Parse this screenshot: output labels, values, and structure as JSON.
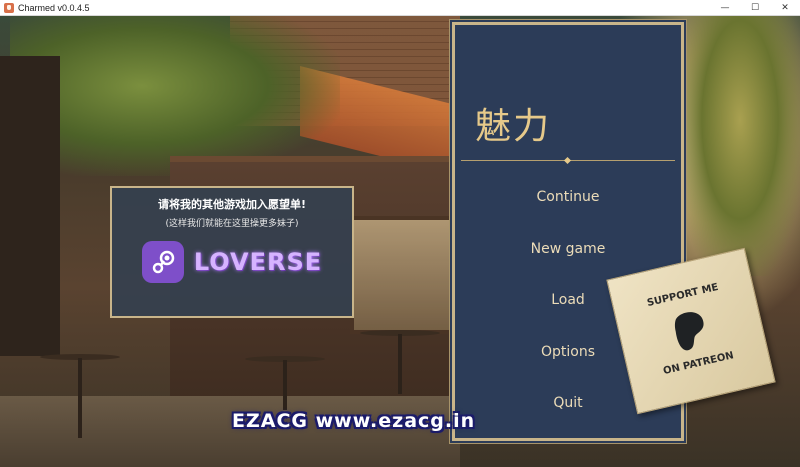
{
  "window": {
    "title": "Charmed v0.0.4.5",
    "controls": {
      "minimize": "—",
      "maximize": "☐",
      "close": "✕"
    }
  },
  "promo": {
    "headline": "请将我的其他游戏加入愿望单!",
    "subline": "(这样我们就能在这里操更多妹子)",
    "brand": "LOVERSE",
    "logo_icon": "steam-icon",
    "accent": "#7e4fc9"
  },
  "menu": {
    "title": "魅力",
    "items": [
      {
        "label": "Continue"
      },
      {
        "label": "New game"
      },
      {
        "label": "Load"
      },
      {
        "label": "Options"
      },
      {
        "label": "Quit"
      }
    ],
    "panel_color": "#2c3c58",
    "border_color": "#c9b58a"
  },
  "patreon": {
    "top_text": "SUPPORT ME",
    "bottom_text": "ON PATREON",
    "icon": "patreon-icon"
  },
  "watermark": {
    "text": "EZACG  www.ezacg.in"
  }
}
